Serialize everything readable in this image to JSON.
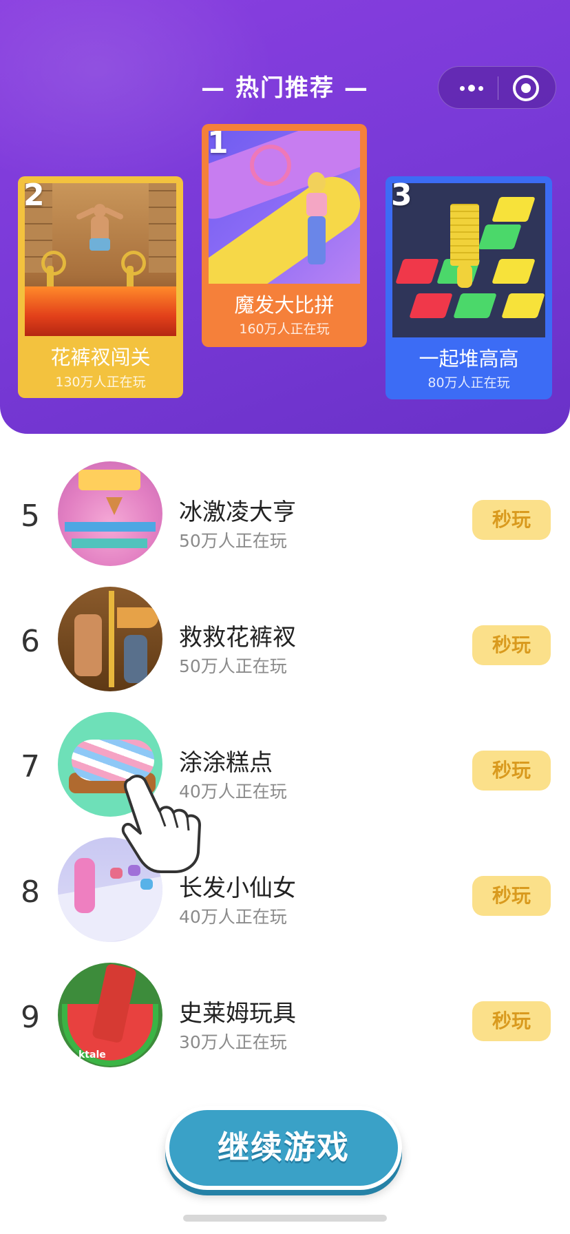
{
  "header": {
    "title": "— 热门推荐 —",
    "menu_icon": "more-dots-icon",
    "close_icon": "target-circle-icon"
  },
  "podium": [
    {
      "rank": "2",
      "name": "花裤衩闯关",
      "players": "130万人正在玩",
      "color": "#f3c23e"
    },
    {
      "rank": "1",
      "name": "魔发大比拼",
      "players": "160万人正在玩",
      "color": "#f5803a"
    },
    {
      "rank": "3",
      "name": "一起堆高高",
      "players": "80万人正在玩",
      "color": "#3c6cf5"
    }
  ],
  "list": [
    {
      "rank": "5",
      "name": "冰激凌大亨",
      "players": "50万人正在玩",
      "action": "秒玩"
    },
    {
      "rank": "6",
      "name": "救救花裤衩",
      "players": "50万人正在玩",
      "action": "秒玩"
    },
    {
      "rank": "7",
      "name": "涂涂糕点",
      "players": "40万人正在玩",
      "action": "秒玩"
    },
    {
      "rank": "8",
      "name": "长发小仙女",
      "players": "40万人正在玩",
      "action": "秒玩"
    },
    {
      "rank": "9",
      "name": "史莱姆玩具",
      "players": "30万人正在玩",
      "action": "秒玩"
    }
  ],
  "avatar_text": {
    "brand": "ktale"
  },
  "continue_button": "继续游戏",
  "colors": {
    "header_gradient_start": "#8a3fe0",
    "header_gradient_end": "#6a31c8",
    "play_button_bg": "#fbe08a",
    "play_button_text": "#d99a1e",
    "continue_button_bg": "#3aa1c7"
  }
}
